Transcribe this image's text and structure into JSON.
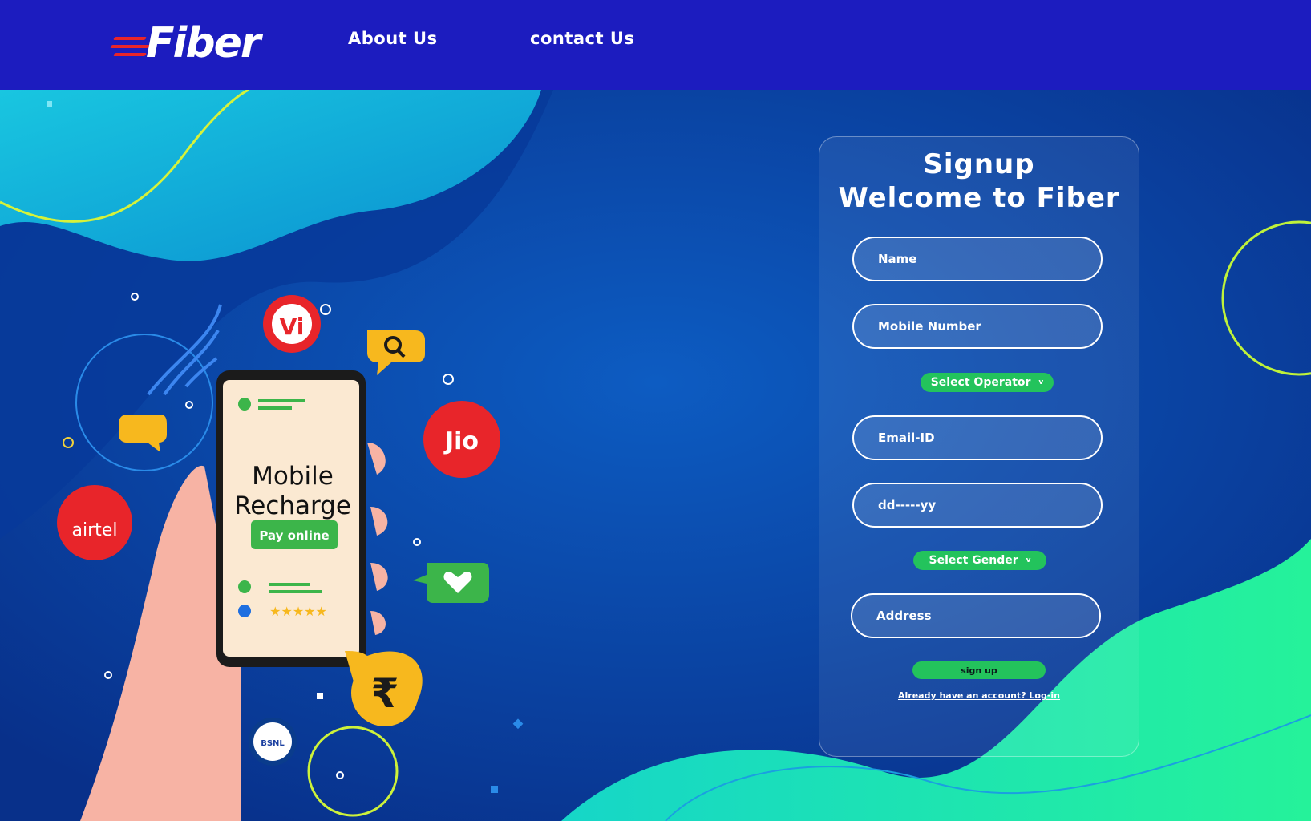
{
  "nav": {
    "logo_text": "Fiber",
    "links": [
      "About Us",
      "contact Us"
    ]
  },
  "illustration": {
    "phone_title_line1": "Mobile",
    "phone_title_line2": "Recharge",
    "pay_button": "Pay online",
    "brands": [
      "Vi",
      "Jio",
      "airtel",
      "BSNL"
    ],
    "rating_stars": "★★★★★",
    "rupee_symbol": "₹"
  },
  "form": {
    "title_line1": "Signup",
    "title_line2": "Welcome to Fiber",
    "name_placeholder": "Name",
    "mobile_placeholder": "Mobile Number",
    "operator_select": "Select Operator",
    "email_placeholder": "Email-ID",
    "dob_placeholder": "dd-----yy",
    "gender_select": "Select Gender",
    "address_placeholder": "Address",
    "submit_label": "sign up",
    "login_link": "Already have an account? Log-in"
  },
  "colors": {
    "nav_bg": "#1c1cbf",
    "accent_green": "#23c35c",
    "brand_red": "#e8252a",
    "bg_blue": "#0b4aa6"
  }
}
